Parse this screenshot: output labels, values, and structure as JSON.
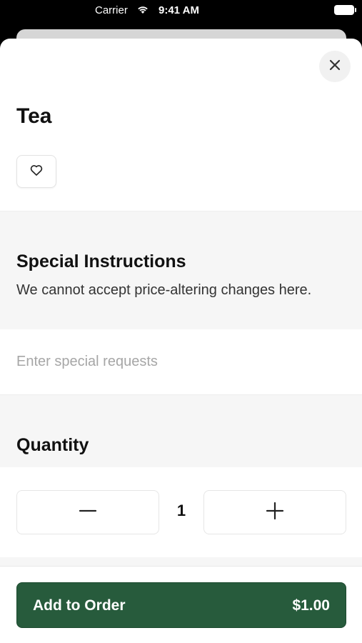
{
  "status_bar": {
    "carrier": "Carrier",
    "time": "9:41 AM"
  },
  "item": {
    "title": "Tea"
  },
  "special_instructions": {
    "title": "Special Instructions",
    "description": "We cannot accept price-altering changes here.",
    "input_placeholder": "Enter special requests",
    "input_value": ""
  },
  "quantity": {
    "title": "Quantity",
    "value": "1"
  },
  "footer": {
    "add_label": "Add to Order",
    "price": "$1.00"
  },
  "colors": {
    "accent": "#275b3c",
    "section_background": "#f6f6f6"
  },
  "icons": {
    "close": "close-icon",
    "favorite": "heart-icon",
    "decrement": "minus-icon",
    "increment": "plus-icon",
    "wifi": "wifi-icon",
    "battery": "battery-icon"
  }
}
